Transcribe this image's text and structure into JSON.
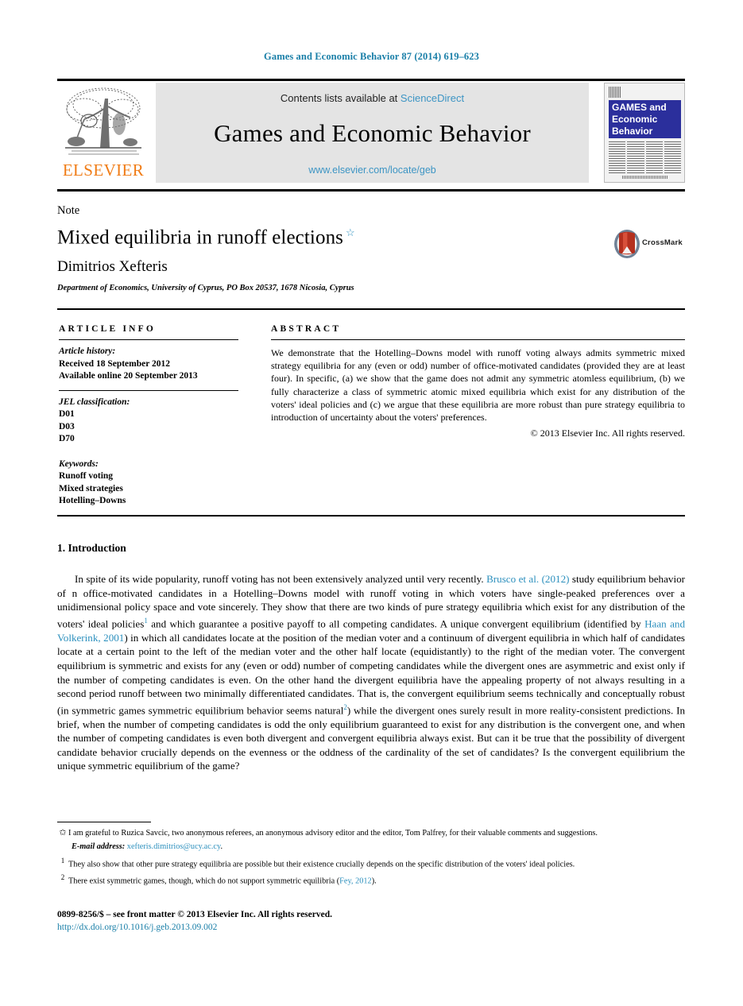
{
  "running_head": "Games and Economic Behavior 87 (2014) 619–623",
  "masthead": {
    "contents_prefix": "Contents lists available at ",
    "sciencedirect": "ScienceDirect",
    "journal_title": "Games and Economic Behavior",
    "journal_url": "www.elsevier.com/locate/geb",
    "publisher": "ELSEVIER",
    "cover_title_line1": "GAMES and",
    "cover_title_line2": "Economic",
    "cover_title_line3": "Behavior"
  },
  "title_block": {
    "note_label": "Note",
    "title": "Mixed equilibria in runoff elections",
    "title_footnote_mark": "☆",
    "author": "Dimitrios Xefteris",
    "affiliation": "Department of Economics, University of Cyprus, PO Box 20537, 1678 Nicosia, Cyprus",
    "crossmark_label": "CrossMark"
  },
  "article_info": {
    "heading": "ARTICLE INFO",
    "history_label": "Article history:",
    "history": [
      "Received 18 September 2012",
      "Available online 20 September 2013"
    ],
    "jel_label": "JEL classification:",
    "jel_codes": [
      "D01",
      "D03",
      "D70"
    ],
    "keywords_label": "Keywords:",
    "keywords": [
      "Runoff voting",
      "Mixed strategies",
      "Hotelling–Downs"
    ]
  },
  "abstract": {
    "heading": "ABSTRACT",
    "text": "We demonstrate that the Hotelling–Downs model with runoff voting always admits symmetric mixed strategy equilibria for any (even or odd) number of office-motivated candidates (provided they are at least four). In specific, (a) we show that the game does not admit any symmetric atomless equilibrium, (b) we fully characterize a class of symmetric atomic mixed equilibria which exist for any distribution of the voters' ideal policies and (c) we argue that these equilibria are more robust than pure strategy equilibria to introduction of uncertainty about the voters' preferences.",
    "rights": "© 2013 Elsevier Inc. All rights reserved."
  },
  "introduction": {
    "heading": "1. Introduction",
    "para_1_a": "In spite of its wide popularity, runoff voting has not been extensively analyzed until very recently. ",
    "ref_brusco": "Brusco et al. (2012)",
    "para_1_b": " study equilibrium behavior of n office-motivated candidates in a Hotelling–Downs model with runoff voting in which voters have single-peaked preferences over a unidimensional policy space and vote sincerely. They show that there are two kinds of pure strategy equilibria which exist for any distribution of the voters' ideal policies",
    "fn_mark_1": "1",
    "para_1_c": " and which guarantee a positive payoff to all competing candidates. A unique convergent equilibrium (identified by ",
    "ref_haan": "Haan and Volkerink, 2001",
    "para_1_d": ") in which all candidates locate at the position of the median voter and a continuum of divergent equilibria in which half of candidates locate at a certain point to the left of the median voter and the other half locate (equidistantly) to the right of the median voter. The convergent equilibrium is symmetric and exists for any (even or odd) number of competing candidates while the divergent ones are asymmetric and exist only if the number of competing candidates is even. On the other hand the divergent equilibria have the appealing property of not always resulting in a second period runoff between two minimally differentiated candidates. That is, the convergent equilibrium seems technically and conceptually robust (in symmetric games symmetric equilibrium behavior seems natural",
    "fn_mark_2": "2",
    "para_1_e": ") while the divergent ones surely result in more reality-consistent predictions. In brief, when the number of competing candidates is odd the only equilibrium guaranteed to exist for any distribution is the convergent one, and when the number of competing candidates is even both divergent and convergent equilibria always exist. But can it be true that the possibility of divergent candidate behavior crucially depends on the evenness or the oddness of the cardinality of the set of candidates? Is the convergent equilibrium the unique symmetric equilibrium of the game?"
  },
  "footnotes": {
    "star_mark": "✩",
    "star_text": "I am grateful to Ruzica Savcic, two anonymous referees, an anonymous advisory editor and the editor, Tom Palfrey, for their valuable comments and suggestions.",
    "email_label": "E-mail address:",
    "email": "xefteris.dimitrios@ucy.ac.cy",
    "email_suffix": ".",
    "note1_mark": "1",
    "note1_text": "They also show that other pure strategy equilibria are possible but their existence crucially depends on the specific distribution of the voters' ideal policies.",
    "note2_mark": "2",
    "note2_text_a": "There exist symmetric games, though, which do not support symmetric equilibria (",
    "note2_ref": "Fey, 2012",
    "note2_text_b": ")."
  },
  "bottom": {
    "issn_line": "0899-8256/$ – see front matter © 2013 Elsevier Inc. All rights reserved.",
    "doi": "http://dx.doi.org/10.1016/j.geb.2013.09.002"
  },
  "colors": {
    "link": "#2b8fbd",
    "running_head": "#1a7fa8",
    "elsevier_orange": "#F07C16",
    "cover_blue": "#2b2f9c"
  }
}
